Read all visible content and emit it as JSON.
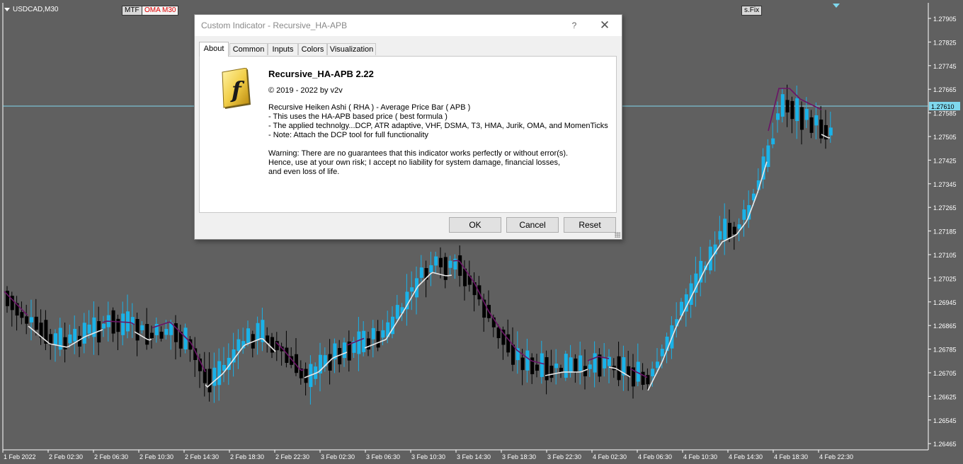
{
  "chart": {
    "symbol": "USDCAD,M30",
    "tags": {
      "mtf": "MTF",
      "oma": "OMA M30",
      "sfix": "s.Fix"
    },
    "price_axis": [
      "1.27905",
      "1.27825",
      "1.27745",
      "1.27665",
      "1.27585",
      "1.27505",
      "1.27425",
      "1.27345",
      "1.27265",
      "1.27185",
      "1.27105",
      "1.27025",
      "1.26945",
      "1.26865",
      "1.26785",
      "1.26705",
      "1.26625",
      "1.26545",
      "1.26465"
    ],
    "current_price": "1.27610",
    "time_axis": [
      "1 Feb 2022",
      "2 Feb 02:30",
      "2 Feb 06:30",
      "2 Feb 10:30",
      "2 Feb 14:30",
      "2 Feb 18:30",
      "2 Feb 22:30",
      "3 Feb 02:30",
      "3 Feb 06:30",
      "3 Feb 10:30",
      "3 Feb 14:30",
      "3 Feb 18:30",
      "3 Feb 22:30",
      "4 Feb 02:30",
      "4 Feb 06:30",
      "4 Feb 10:30",
      "4 Feb 14:30",
      "4 Feb 18:30",
      "4 Feb 22:30"
    ],
    "colors": {
      "background": "#606060",
      "bull": "#1ab2e8",
      "bear": "#000000",
      "grid_axis": "#ffffff",
      "line_up": "#e8e8e8",
      "line_down": "#6b1467",
      "price_line": "#7fd8ee"
    }
  },
  "dialog": {
    "title": "Custom Indicator - Recursive_HA-APB",
    "help": "?",
    "close": "✕",
    "tabs": [
      "About",
      "Common",
      "Inputs",
      "Colors",
      "Visualization"
    ],
    "active_tab": "About",
    "logo_icon": "indicator-f-icon",
    "about": {
      "name": "Recursive_HA-APB 2.22",
      "copyright": "© 2019 - 2022 by v2v",
      "description": [
        "Recursive Heiken Ashi ( RHA ) - Average Price Bar ( APB )",
        "- This uses the HA-APB based price ( best formula )",
        "- The applied technolgy...DCP, ATR adaptive, VHF, DSMA, T3, HMA, Jurik, OMA, and MomenTicks",
        "- Note: Attach the DCP tool for full functionality"
      ],
      "warning": [
        "Warning: There are no guarantees that this indicator works perfectly or without error(s).",
        "Hence, use at your own risk; I accept no liability for system damage, financial losses,",
        "and even loss of life."
      ]
    },
    "buttons": {
      "ok": "OK",
      "cancel": "Cancel",
      "reset": "Reset"
    }
  }
}
